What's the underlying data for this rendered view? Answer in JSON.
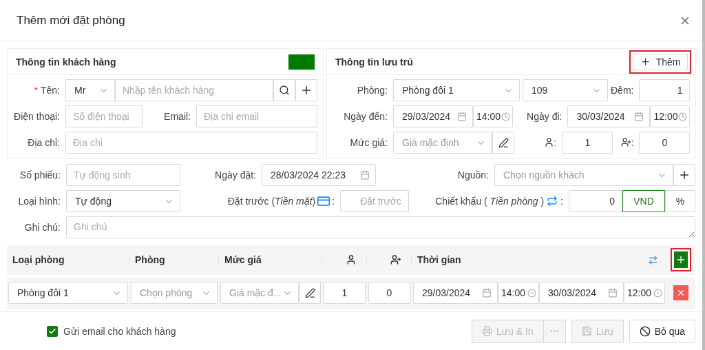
{
  "separator": ":",
  "dialog": {
    "title": "Thêm mới đặt phòng"
  },
  "customer": {
    "title": "Thông tin khách hàng",
    "color": "#007a00",
    "name": {
      "label": "Tên",
      "required_mark": "*",
      "salutation": "Mr",
      "placeholder": "Nhập tên khách hàng"
    },
    "phone": {
      "label": "Điện thoại",
      "placeholder": "Số điện thoại"
    },
    "email": {
      "label": "Email",
      "placeholder": "Địa chỉ email"
    },
    "address": {
      "label": "Địa chỉ",
      "placeholder": "Địa chỉ"
    }
  },
  "stay": {
    "title": "Thông tin lưu trú",
    "add_button": {
      "label": "Thêm",
      "highlighted": true
    },
    "room_label": "Phòng",
    "room_type": "Phòng đôi 1",
    "room_number": "109",
    "nights_label": "Đêm",
    "nights": "1",
    "arrival_label": "Ngày đến",
    "arrival_date": "29/03/2024",
    "arrival_time": "14:00",
    "departure_label": "Ngày đi",
    "departure_date": "30/03/2024",
    "departure_time": "12:00",
    "rate_label": "Mức giá",
    "rate_placeholder": "Giá mặc định",
    "adults": "1",
    "children": "0"
  },
  "booking": {
    "voucher_label": "Số phiếu",
    "voucher_placeholder": "Tự động sinh",
    "date_label": "Ngày đặt",
    "date": "28/03/2024 22:23",
    "source_label": "Nguồn",
    "source_placeholder": "Chọn nguồn khách",
    "type_label": "Loại hình",
    "type": "Tự động",
    "deposit_label": "Đặt trước (*Tiền mặt*)",
    "deposit_placeholder": "Đặt trước",
    "discount_label": "Chiết khấu ( *Tiền phòng* )",
    "discount": "0",
    "units": [
      {
        "label": "VND",
        "selected": true
      },
      {
        "label": "%",
        "selected": false
      }
    ],
    "note_label": "Ghi chú",
    "note_placeholder": "Ghi chú"
  },
  "table": {
    "columns": [
      {
        "kind": "text",
        "label": "Loại phòng"
      },
      {
        "kind": "text",
        "label": "Phòng"
      },
      {
        "kind": "text",
        "label": "Mức giá"
      },
      {
        "kind": "adults"
      },
      {
        "kind": "children"
      },
      {
        "kind": "text",
        "label": "Thời gian"
      }
    ],
    "add_button": {
      "highlighted": true
    },
    "rows": [
      {
        "room_type": "Phòng đôi 1",
        "room_placeholder": "Chọn phòng",
        "rate": "Giá mặc đ...",
        "adults": "1",
        "children": "0",
        "arrival_date": "29/03/2024",
        "arrival_time": "14:00",
        "departure_date": "30/03/2024",
        "departure_time": "12:00"
      }
    ]
  },
  "footer": {
    "send_email": {
      "label": "Gửi email cho khách hàng",
      "checked": true
    },
    "buttons": [
      {
        "kind": "print",
        "label": "Lưu & In",
        "disabled": true
      },
      {
        "kind": "more",
        "disabled": true
      },
      {
        "kind": "save",
        "label": "Lưu",
        "disabled": true
      },
      {
        "kind": "cancel",
        "label": "Bỏ qua",
        "disabled": false
      }
    ]
  }
}
